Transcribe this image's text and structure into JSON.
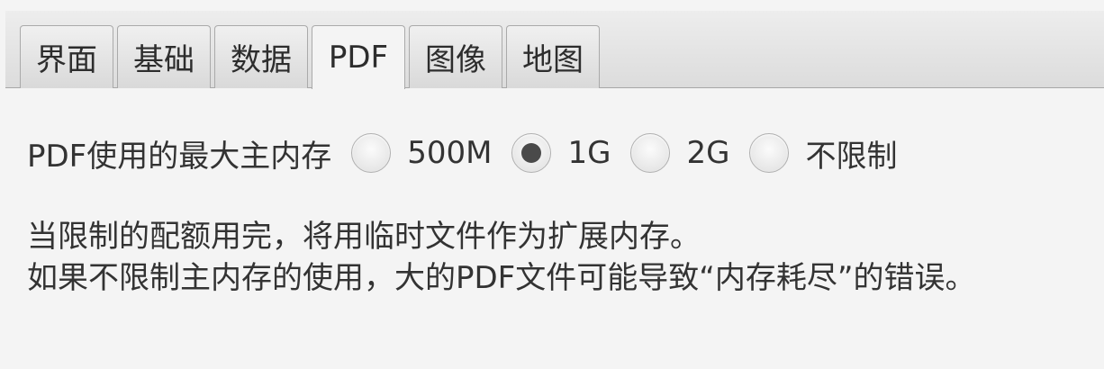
{
  "tabs": [
    {
      "label": "界面",
      "active": false
    },
    {
      "label": "基础",
      "active": false
    },
    {
      "label": "数据",
      "active": false
    },
    {
      "label": "PDF",
      "active": true
    },
    {
      "label": "图像",
      "active": false
    },
    {
      "label": "地图",
      "active": false
    }
  ],
  "pdf_memory": {
    "label": "PDF使用的最大主内存",
    "options": [
      {
        "label": "500M",
        "selected": false
      },
      {
        "label": "1G",
        "selected": true
      },
      {
        "label": "2G",
        "selected": false
      },
      {
        "label": "不限制",
        "selected": false
      }
    ]
  },
  "notes": {
    "line1": "当限制的配额用完，将用临时文件作为扩展内存。",
    "line2": "如果不限制主内存的使用，大的PDF文件可能导致“内存耗尽”的错误。"
  }
}
